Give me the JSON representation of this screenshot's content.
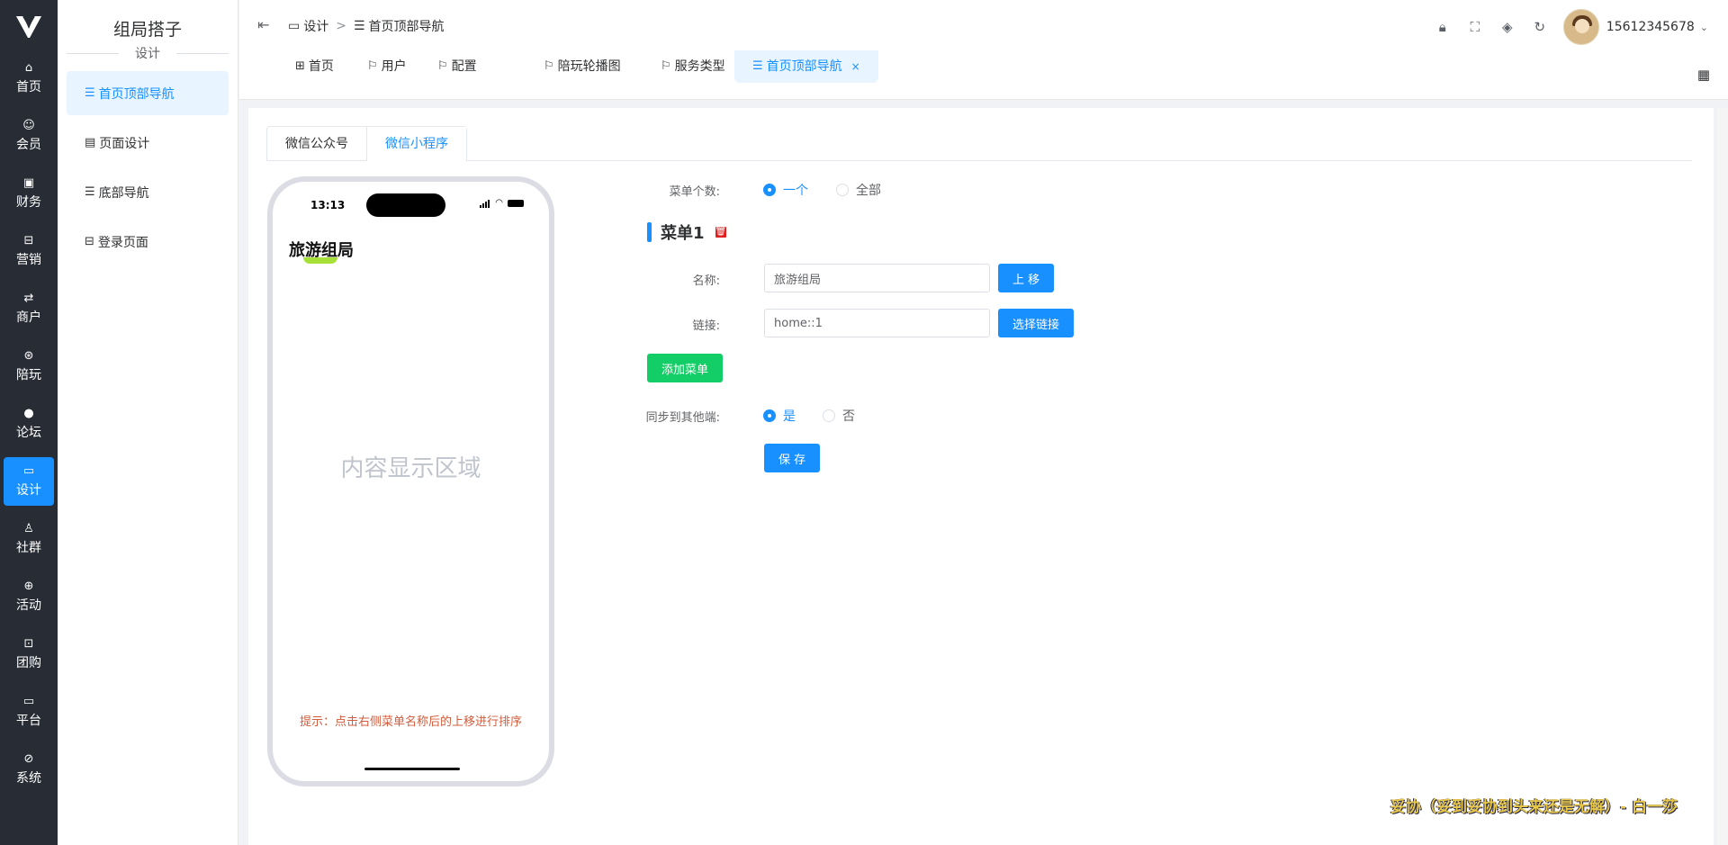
{
  "rail": {
    "items": [
      {
        "label": "首页",
        "icon": "home-icon"
      },
      {
        "label": "会员",
        "icon": "member-icon"
      },
      {
        "label": "财务",
        "icon": "finance-icon"
      },
      {
        "label": "营销",
        "icon": "marketing-icon"
      },
      {
        "label": "商户",
        "icon": "merchant-icon"
      },
      {
        "label": "陪玩",
        "icon": "companion-icon"
      },
      {
        "label": "论坛",
        "icon": "forum-icon"
      },
      {
        "label": "设计",
        "icon": "design-icon"
      },
      {
        "label": "社群",
        "icon": "community-icon"
      },
      {
        "label": "活动",
        "icon": "activity-icon"
      },
      {
        "label": "团购",
        "icon": "group-buy-icon"
      },
      {
        "label": "平台",
        "icon": "platform-icon"
      },
      {
        "label": "系统",
        "icon": "system-icon"
      }
    ],
    "active": "设计"
  },
  "submenu": {
    "title": "组局搭子",
    "group": "设计",
    "items": [
      {
        "label": "首页顶部导航"
      },
      {
        "label": "页面设计"
      },
      {
        "label": "底部导航"
      },
      {
        "label": "登录页面"
      }
    ]
  },
  "breadcrumb": {
    "first": "设计",
    "separator": ">",
    "second": "首页顶部导航"
  },
  "user": {
    "name": "15612345678"
  },
  "tags": {
    "items": [
      {
        "label": "首页"
      },
      {
        "label": "用户"
      },
      {
        "label": "配置"
      },
      {
        "label": "陪玩轮播图"
      },
      {
        "label": "服务类型"
      },
      {
        "label": "首页顶部导航"
      }
    ],
    "close": "×"
  },
  "tabs": {
    "items": [
      {
        "label": "微信公众号"
      },
      {
        "label": "微信小程序"
      }
    ],
    "active": "微信小程序"
  },
  "phone": {
    "time": "13:13",
    "title": "旅游组局",
    "content_placeholder": "内容显示区域",
    "hint": "提示：点击右侧菜单名称后的上移进行排序"
  },
  "form": {
    "menu_count_label": "菜单个数:",
    "menu_count_options": [
      "一个",
      "全部"
    ],
    "menu_title": "菜单1",
    "name_label": "名称:",
    "name_value": "旅游组局",
    "move_up": "上 移",
    "link_label": "链接:",
    "link_value": "home::1",
    "select_link": "选择链接",
    "add_menu": "添加菜单",
    "sync_label": "同步到其他端:",
    "sync_options": [
      "是",
      "否"
    ],
    "save": "保 存"
  },
  "slogan": "妥协（妥到妥协到头来还是无解）- 白一莎",
  "colors": {
    "primary": "#1890ff",
    "success": "#13ce66",
    "rail_bg": "#282c34",
    "danger": "#e02020"
  }
}
